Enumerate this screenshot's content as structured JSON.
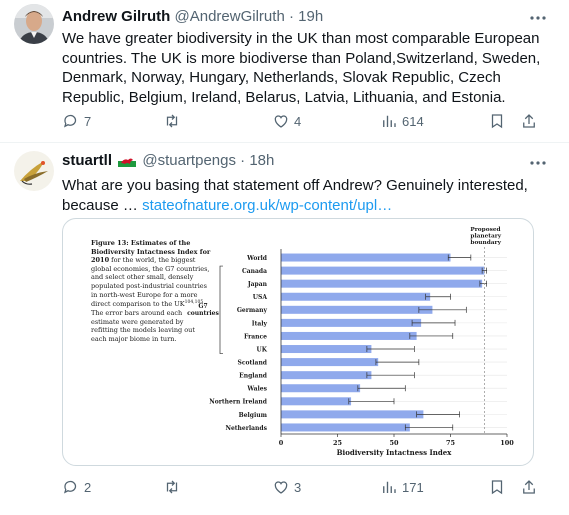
{
  "tweet1": {
    "name": "Andrew Gilruth",
    "handle": "@AndrewGilruth",
    "separator": "·",
    "time": "19h",
    "text": "We have greater biodiversity in the UK than most comparable European countries. The UK is more biodiverse than Poland,Switzerland, Sweden, Denmark, Norway, Hungary, Netherlands, Slovak Republic, Czech Republic, Belgium, Ireland, Belarus, Latvia, Lithuania, and Estonia.",
    "replies": "7",
    "retweets": "",
    "likes": "4",
    "views": "614"
  },
  "tweet2": {
    "name": "stuartll",
    "flag_icon": "wales-flag-icon",
    "handle": "@stuartpengs",
    "separator": "·",
    "time": "18h",
    "text": "What are you basing that statement off Andrew? Genuinely interested, because …",
    "link": "stateofnature.org.uk/wp-content/upl…",
    "replies": "2",
    "retweets": "",
    "likes": "3",
    "views": "171"
  },
  "figure": {
    "caption_title": "Figure 13: Estimates of the Biodiversity Intactness Index for 2010",
    "caption_body": "for the world, the biggest global economies, the G7 countries, and select other small, densely populated post-industrial countries in north-west Europe for a more direct comparison to the UK",
    "caption_ref": "104,105",
    "caption_tail": ". The error bars around each estimate were generated by refitting the models leaving out each major biome in turn."
  },
  "chart_data": {
    "type": "bar",
    "orientation": "horizontal",
    "categories": [
      "World",
      "Canada",
      "Japan",
      "USA",
      "Germany",
      "Italy",
      "France",
      "UK",
      "Scotland",
      "England",
      "Wales",
      "Northern Ireland",
      "Belgium",
      "Netherlands"
    ],
    "values": [
      75,
      90,
      89,
      66,
      67,
      62,
      60,
      40,
      43,
      40,
      35,
      31,
      63,
      57
    ],
    "error_low": [
      74,
      89,
      88,
      64,
      61,
      58,
      57,
      38,
      42,
      38,
      34,
      30,
      60,
      55
    ],
    "error_high": [
      84,
      91,
      91,
      75,
      82,
      77,
      76,
      59,
      61,
      59,
      55,
      50,
      79,
      76
    ],
    "group_label": "G7 countries",
    "group_members": [
      "Canada",
      "Japan",
      "USA",
      "Germany",
      "Italy",
      "France",
      "UK"
    ],
    "xlabel": "Biodiversity Intactness Index",
    "xticks": [
      0,
      25,
      50,
      75,
      100
    ],
    "xlim": [
      0,
      100
    ],
    "boundary_value": 90,
    "boundary_label": "Proposed planetary boundary",
    "colors": {
      "bar": "#8fa9ec",
      "error": "#333333",
      "boundary": "#999999"
    }
  }
}
